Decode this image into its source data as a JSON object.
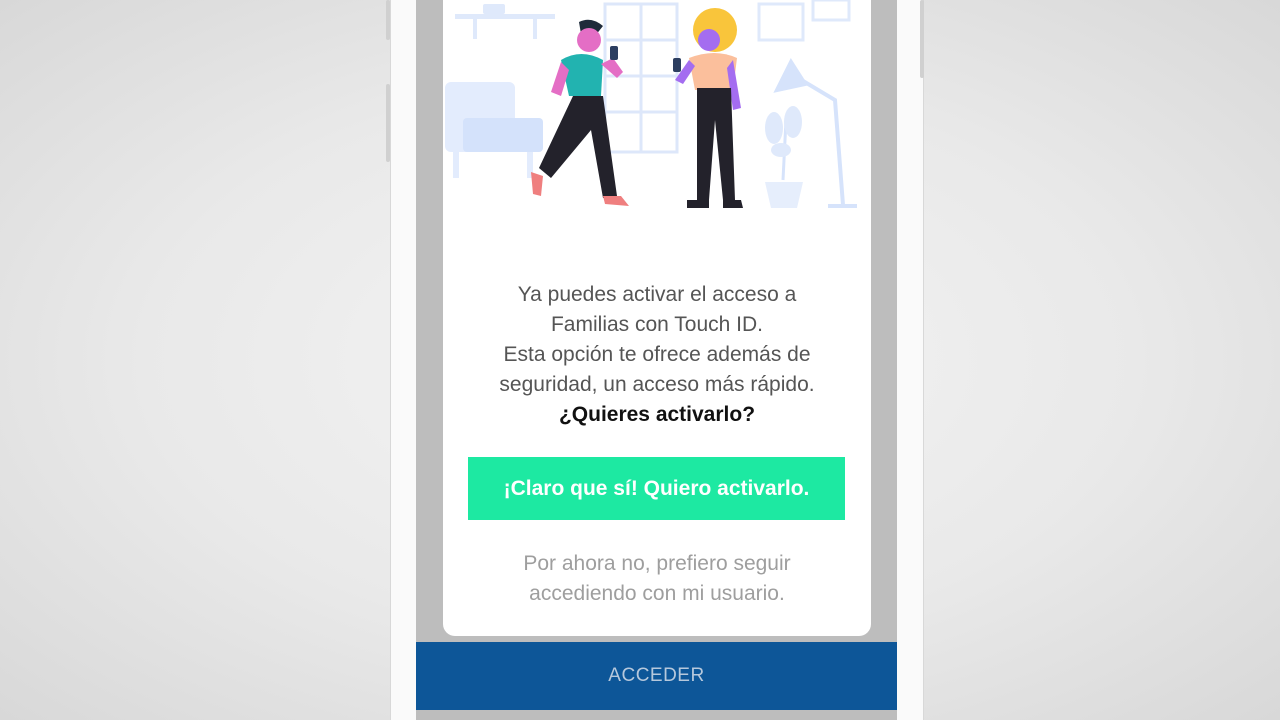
{
  "modal": {
    "message_lines": [
      "Ya puedes activar el acceso a",
      "Familias con Touch ID.",
      "Esta opción te ofrece además de",
      "seguridad, un acceso más rápido."
    ],
    "question": "¿Quieres activarlo?",
    "primary_button_label": "¡Claro que sí! Quiero activarlo.",
    "secondary_link_lines": [
      "Por ahora no, prefiero seguir",
      "accediendo con mi usuario."
    ]
  },
  "footer": {
    "acceder_label": "ACCEDER"
  },
  "colors": {
    "primary_button": "#1de9a2",
    "footer_button": "#0d5698",
    "secondary_text": "#9e9e9e"
  },
  "icons": [
    "people-illustration",
    "lamp-icon",
    "plant-icon",
    "armchair-icon",
    "bookshelf-icon"
  ]
}
